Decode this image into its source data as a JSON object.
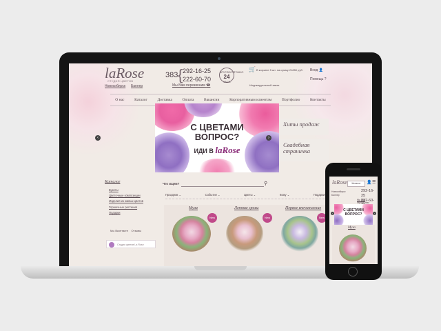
{
  "site": {
    "logo": "laRose",
    "logo_sub": "СТУДИЯ ЦВЕТОВ",
    "city": "Новосибирск",
    "call_link": "Баннер",
    "phone_code": "383",
    "phones": [
      "292-16-25",
      "222-60-70"
    ],
    "callback": "Мы Вам перезвоним",
    "hours_top": "КРУГЛОСУТОЧНО",
    "hours_num": "24",
    "hours_bottom": "ЧАСА",
    "cart_text": "В корзине 5 шт. на сумму 21850 руб.",
    "personal": "Индивидуальный заказ",
    "login": "Вход",
    "help": "Помощь"
  },
  "nav": [
    "О нас",
    "Каталог",
    "Доставка",
    "Оплата",
    "Вакансии",
    "Корпоративным клиентам",
    "Портфолио",
    "Контакты"
  ],
  "banner": {
    "title_1": "С ЦВЕТАМИ",
    "title_2": "ВОПРОС?",
    "sub": "ИДИ В",
    "logo": "laRose"
  },
  "side_cards": [
    "Хиты продаж",
    "Свадебная страничка"
  ],
  "catalog": {
    "title": "Каталог",
    "items": [
      "Букеты",
      "Цветочные композиции",
      "Изделия из живых цветов",
      "Горшечные растения",
      "Подарки"
    ],
    "links": [
      "Мы Вконтакте",
      "Отзывы"
    ],
    "studio": "Студия цветов La Rose"
  },
  "search": {
    "label": "Что ищем?"
  },
  "filters": [
    "Праздник",
    "Событие",
    "Цветы",
    "Кому",
    "Подарки"
  ],
  "products": [
    {
      "name": "Муза",
      "badge": "New"
    },
    {
      "name": "Летние грезы",
      "badge": "New"
    },
    {
      "name": "Первое впечатление",
      "badge": "New"
    }
  ],
  "mobile": {
    "logo": "laRose",
    "catalog_btn": "Каталог",
    "city": "Новосибирск",
    "call": "Баннер",
    "phones": [
      "292-16-25",
      "222-60-70"
    ],
    "callback": "Мы Вам перезвоним",
    "banner_title_1": "С ЦВЕТАМИ",
    "banner_title_2": "ВОПРОС?",
    "product": "Муза"
  }
}
